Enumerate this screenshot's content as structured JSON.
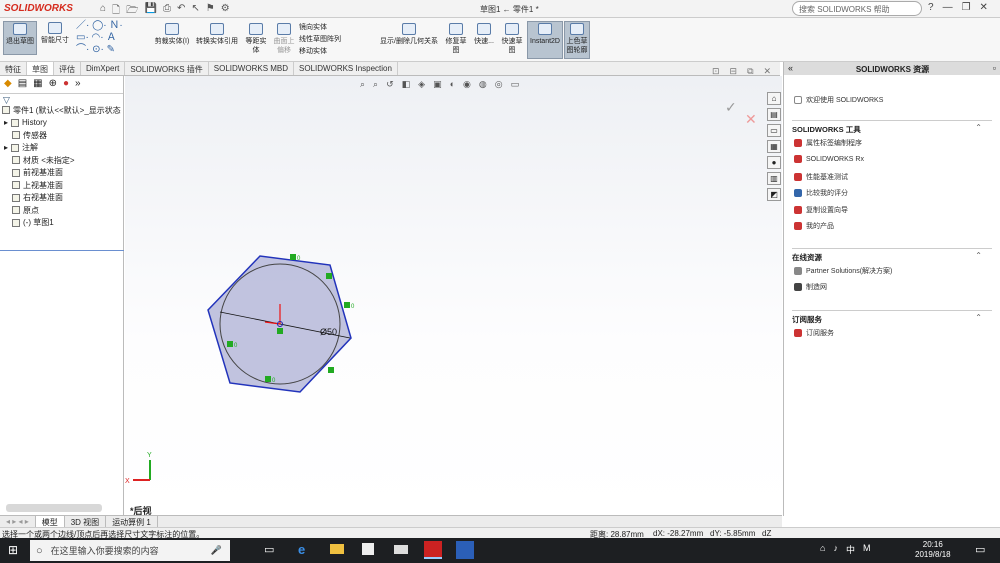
{
  "app": {
    "logo": "SOLIDWORKS",
    "window_title": "草图1 ← 零件1 *",
    "help_placeholder": "搜索 SOLIDWORKS 帮助",
    "win_controls": [
      "?",
      "—",
      "❐",
      "✕"
    ]
  },
  "ribbon": {
    "exit_sketch": "退出草图",
    "smart_dimension": "智能尺寸",
    "trim": "剪裁实体(I)",
    "convert": "转换实体引用",
    "offset": "等距实体",
    "surface_offset": "曲面上偏移",
    "mirror": "镜向实体",
    "linear_pattern": "线性草图阵列",
    "move": "移动实体",
    "relations": "显示/删除几何关系",
    "repair": "修复草图",
    "quick_snaps": "快速...",
    "quick_sketch": "快速草图",
    "instant2d": "Instant2D",
    "shaded_sketch": "上色草图轮廓"
  },
  "tabs": [
    "特征",
    "草图",
    "评估",
    "DimXpert",
    "SOLIDWORKS 插件",
    "SOLIDWORKS MBD",
    "SOLIDWORKS Inspection"
  ],
  "tree": [
    {
      "label": "零件1 (默认<<默认>_显示状态",
      "expand": ""
    },
    {
      "label": "History",
      "expand": "▸"
    },
    {
      "label": "传感器",
      "expand": ""
    },
    {
      "label": "注解",
      "expand": "▸"
    },
    {
      "label": "材质 <未指定>",
      "expand": ""
    },
    {
      "label": "前视基准面",
      "expand": ""
    },
    {
      "label": "上视基准面",
      "expand": ""
    },
    {
      "label": "右视基准面",
      "expand": ""
    },
    {
      "label": "原点",
      "expand": ""
    },
    {
      "label": "(-) 草图1",
      "expand": ""
    }
  ],
  "canvas": {
    "dimension": "Ø50",
    "view_label": "*后视",
    "x_axis": "X",
    "y_axis": "Y",
    "relation_marker": "0"
  },
  "resources": {
    "title": "SOLIDWORKS 资源",
    "welcome": "欢迎使用 SOLIDWORKS",
    "tools_header": "SOLIDWORKS 工具",
    "tools": [
      "属性标签编制程序",
      "SOLIDWORKS Rx",
      "性能基准测试",
      "比较我的评分",
      "复制设置向导",
      "我的产品"
    ],
    "online_header": "在线资源",
    "online": [
      "Partner Solutions(解决方案)",
      "制造网"
    ],
    "subscription_header": "订阅服务",
    "subscription": [
      "订阅服务"
    ]
  },
  "bottom_tabs": [
    "模型",
    "3D 视图",
    "运动算例 1"
  ],
  "status": {
    "hint": "选择一个或两个边线/顶点后再选择尺寸文字标注的位置。",
    "distance": "距离: 28.87mm",
    "dx": "dX: -28.27mm",
    "dy": "dY: -5.85mm",
    "dz": "dZ"
  },
  "taskbar": {
    "search_placeholder": "在这里输入你要搜索的内容",
    "time": "20:16",
    "date": "2019/8/18",
    "ime": "M",
    "lang": "中"
  }
}
